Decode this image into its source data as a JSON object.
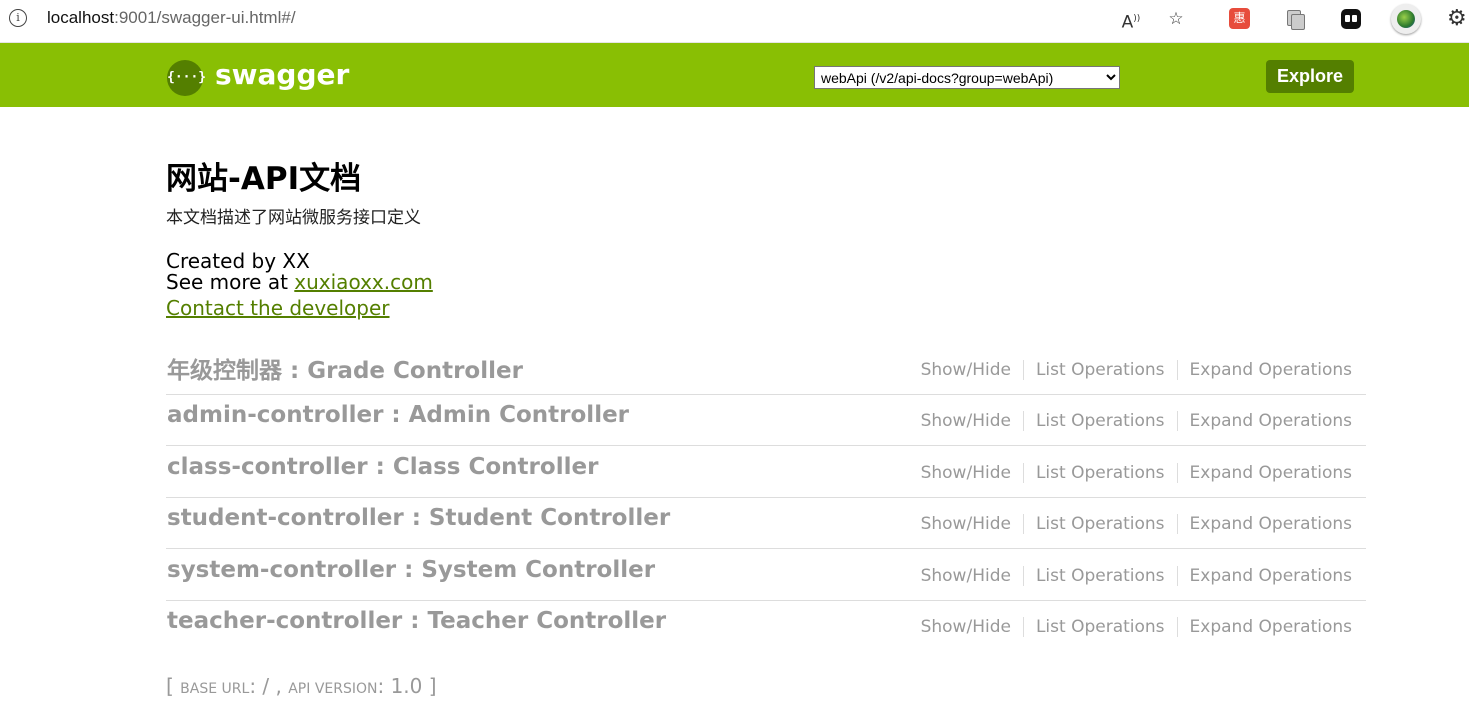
{
  "browser": {
    "url_host": "localhost",
    "url_rest": ":9001/swagger-ui.html#/",
    "ext1_label": "惠"
  },
  "header": {
    "logo_glyph": "{···}",
    "logo_text": "swagger",
    "api_select_value": "webApi (/v2/api-docs?group=webApi)",
    "explore_label": "Explore",
    "background_color": "#89bf04",
    "accent_color": "#547f00"
  },
  "info": {
    "title": "网站-API文档",
    "description": "本文档描述了网站微服务接口定义",
    "created_by": "Created by XX",
    "see_more_prefix": "See more at ",
    "see_more_link": "xuxiaoxx.com",
    "contact": "Contact the developer"
  },
  "resources": [
    {
      "name": "年级控制器 : Grade Controller"
    },
    {
      "name": "admin-controller : Admin Controller"
    },
    {
      "name": "class-controller : Class Controller"
    },
    {
      "name": "student-controller : Student Controller"
    },
    {
      "name": "system-controller : System Controller"
    },
    {
      "name": "teacher-controller : Teacher Controller"
    }
  ],
  "operations": {
    "show_hide": "Show/Hide",
    "list": "List Operations",
    "expand": "Expand Operations"
  },
  "footer": {
    "open_bracket": "[ ",
    "base_url_label": "BASE URL",
    "base_url_value": ": / , ",
    "api_version_label": "API VERSION",
    "api_version_value": ": 1.0 ",
    "close_bracket": "]"
  }
}
